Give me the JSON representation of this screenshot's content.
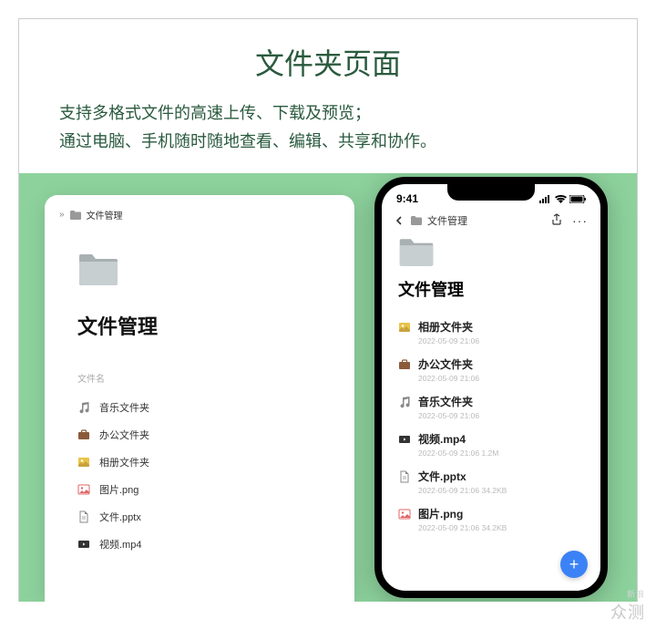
{
  "heading": "文件夹页面",
  "subheading_line1": "支持多格式文件的高速上传、下载及预览；",
  "subheading_line2": "通过电脑、手机随时随地查看、编辑、共享和协作。",
  "watermark_small": "新浪",
  "watermark_large": "众测",
  "desktop": {
    "breadcrumb_sep": "»",
    "breadcrumb_label": "文件管理",
    "title": "文件管理",
    "column_header": "文件名",
    "rows": [
      {
        "icon": "music",
        "label": "音乐文件夹"
      },
      {
        "icon": "briefcase",
        "label": "办公文件夹"
      },
      {
        "icon": "album",
        "label": "相册文件夹"
      },
      {
        "icon": "image",
        "label": "图片.png"
      },
      {
        "icon": "doc",
        "label": "文件.pptx"
      },
      {
        "icon": "video",
        "label": "视频.mp4"
      }
    ]
  },
  "phone": {
    "status_time": "9:41",
    "breadcrumb_label": "文件管理",
    "title": "文件管理",
    "rows": [
      {
        "icon": "album",
        "label": "相册文件夹",
        "meta": "2022-05-09 21:06"
      },
      {
        "icon": "briefcase",
        "label": "办公文件夹",
        "meta": "2022-05-09 21:06"
      },
      {
        "icon": "music",
        "label": "音乐文件夹",
        "meta": "2022-05-09 21:06"
      },
      {
        "icon": "video",
        "label": "视频.mp4",
        "meta": "2022-05-09 21:06   1.2M"
      },
      {
        "icon": "doc",
        "label": "文件.pptx",
        "meta": "2022-05-09 21:06   34.2KB"
      },
      {
        "icon": "image",
        "label": "图片.png",
        "meta": "2022-05-09 21:06   34.2KB"
      }
    ],
    "fab_label": "+"
  }
}
